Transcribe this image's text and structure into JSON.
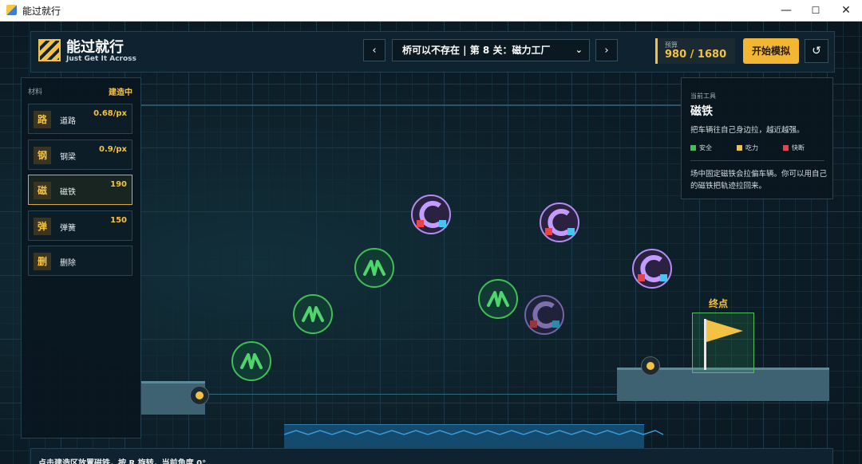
{
  "window": {
    "title": "能过就行",
    "minimize": "—",
    "maximize": "☐",
    "close": "✕"
  },
  "header": {
    "title": "能过就行",
    "subtitle": "Just Get It Across",
    "prev": "‹",
    "next": "›",
    "level": "桥可以不存在 | 第 8 关：磁力工厂",
    "budget_label": "预算",
    "budget_value": "980 / 1680",
    "start": "开始模拟",
    "reset": "↺"
  },
  "materials": {
    "label": "材料",
    "state": "建造中",
    "items": [
      {
        "badge": "路",
        "name": "道路",
        "price": "0.68/px"
      },
      {
        "badge": "钢",
        "name": "钢梁",
        "price": "0.9/px"
      },
      {
        "badge": "磁",
        "name": "磁铁",
        "price": "190"
      },
      {
        "badge": "弹",
        "name": "弹簧",
        "price": "150"
      },
      {
        "badge": "删",
        "name": "删除",
        "price": ""
      }
    ]
  },
  "tool": {
    "label": "当前工具",
    "name": "磁铁",
    "description": "把车辆往自己身边拉，越近越强。",
    "legend": [
      {
        "text": "安全",
        "color": "#3fbf54"
      },
      {
        "text": "吃力",
        "color": "#f3c245"
      },
      {
        "text": "快断",
        "color": "#e8434a"
      }
    ],
    "note": "场中固定磁铁会拉偏车辆。你可以用自己的磁铁把轨迹拉回来。"
  },
  "world": {
    "goal_label": "终点"
  },
  "status": {
    "text": "点击建造区放置磁铁，按 R 旋转，当前角度 0°"
  },
  "colors": {
    "accent": "#f3c245",
    "magnet": "#b48cf2",
    "spring": "#3fbf54"
  }
}
